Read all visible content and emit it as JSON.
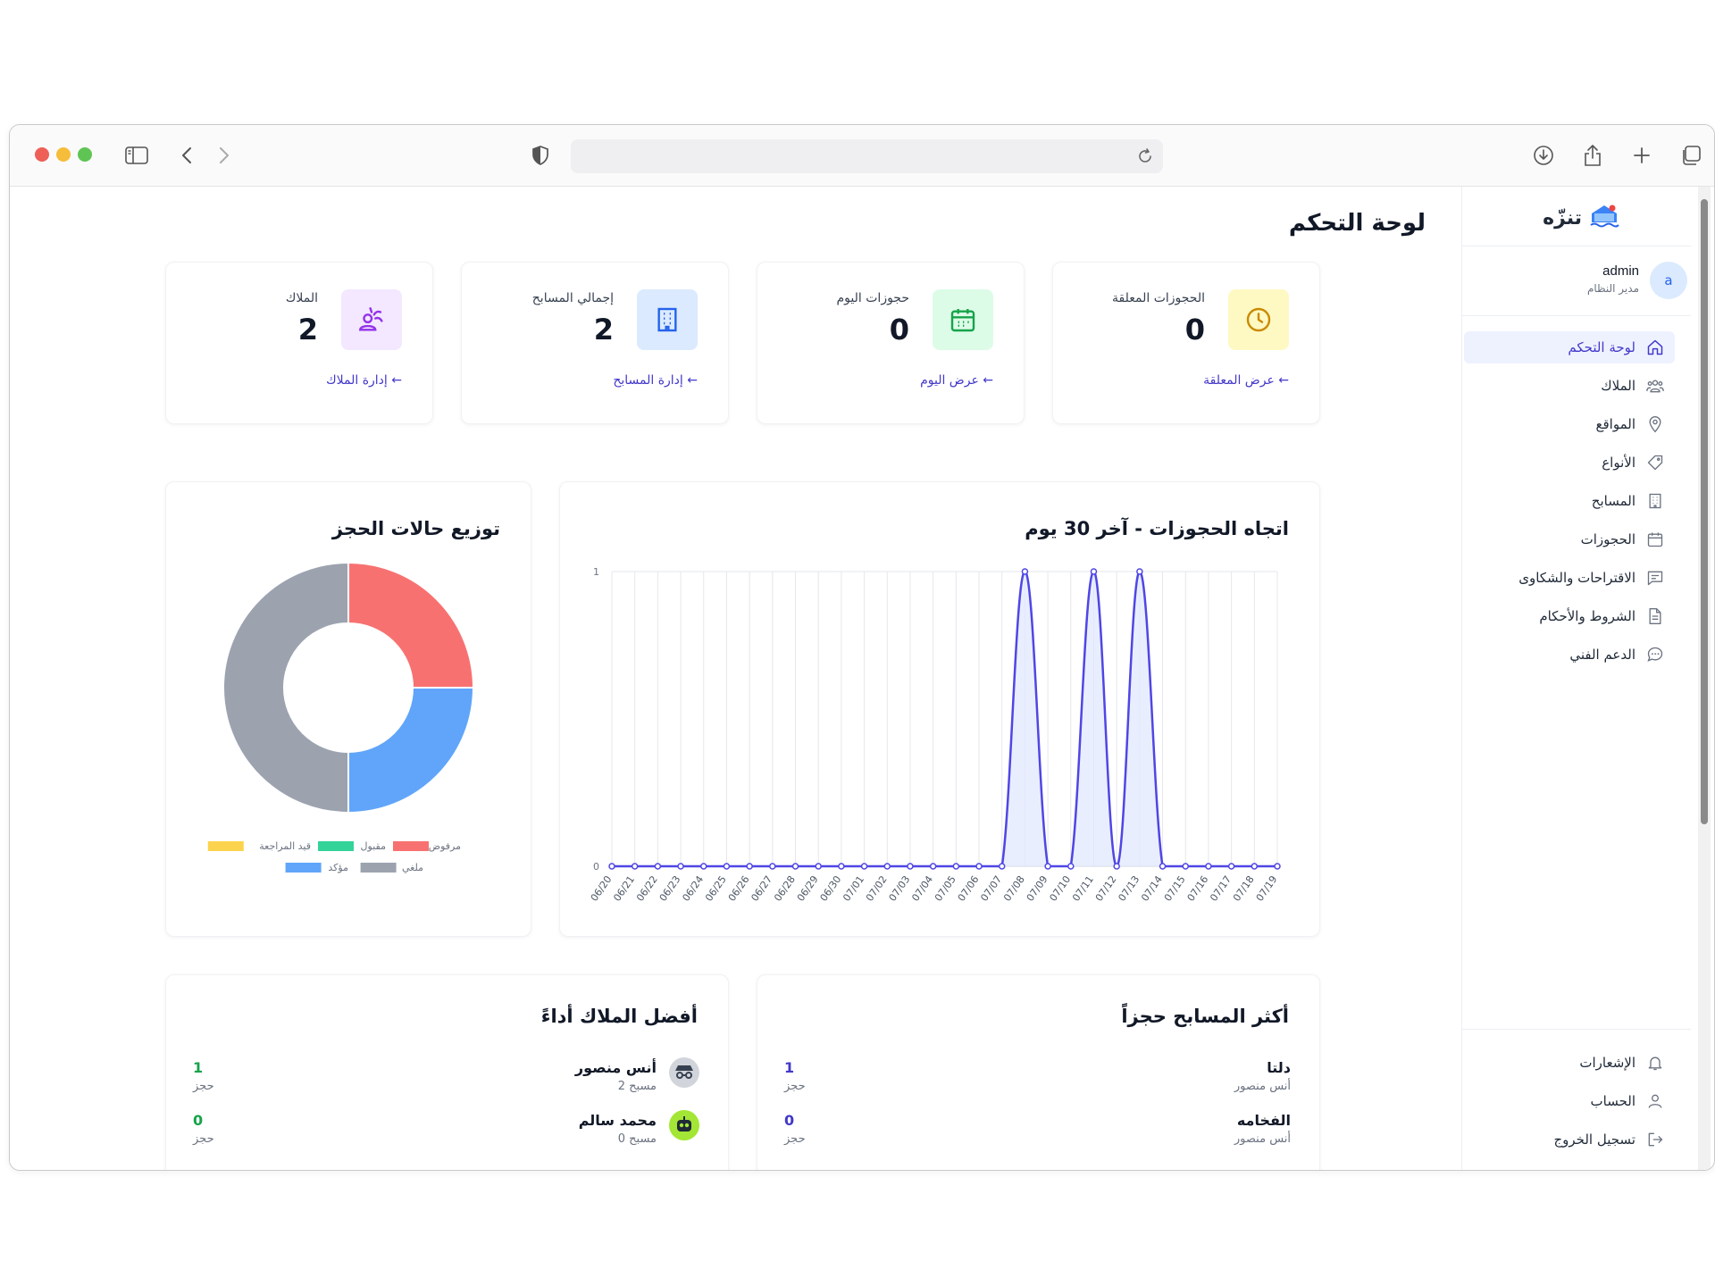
{
  "sidebar": {
    "brand": "تنزّه",
    "user": {
      "name": "admin",
      "role": "مدير النظام",
      "initial": "a"
    },
    "nav": [
      {
        "label": "لوحة التحكم",
        "icon": "home-icon",
        "active": true
      },
      {
        "label": "الملاك",
        "icon": "users-icon"
      },
      {
        "label": "المواقع",
        "icon": "map-pin-icon"
      },
      {
        "label": "الأنواع",
        "icon": "tag-icon"
      },
      {
        "label": "المسابح",
        "icon": "building-icon"
      },
      {
        "label": "الحجوزات",
        "icon": "calendar-icon"
      },
      {
        "label": "الاقتراحات والشكاوى",
        "icon": "message-square-icon"
      },
      {
        "label": "الشروط والأحكام",
        "icon": "file-text-icon"
      },
      {
        "label": "الدعم الفني",
        "icon": "chat-bubble-icon"
      }
    ],
    "bottom": [
      {
        "label": "الإشعارات",
        "icon": "bell-icon"
      },
      {
        "label": "الحساب",
        "icon": "user-icon"
      },
      {
        "label": "تسجيل الخروج",
        "icon": "logout-icon"
      }
    ]
  },
  "page_title": "لوحة التحكم",
  "stats": [
    {
      "label": "الحجوزات المعلقة",
      "value": "0",
      "link": "عرض المعلقة ←",
      "icon": "clock-icon",
      "color": "#ca8a04",
      "bg": "#fef9c3"
    },
    {
      "label": "حجوزات اليوم",
      "value": "0",
      "link": "عرض اليوم ←",
      "icon": "calendar-icon",
      "color": "#16a34a",
      "bg": "#dcfce7"
    },
    {
      "label": "إجمالي المسابح",
      "value": "2",
      "link": "إدارة المسابح ←",
      "icon": "building-icon",
      "color": "#2563eb",
      "bg": "#dbeafe"
    },
    {
      "label": "الملاك",
      "value": "2",
      "link": "إدارة الملاك ←",
      "icon": "owners-icon",
      "color": "#9333ea",
      "bg": "#f3e8ff"
    }
  ],
  "trend": {
    "title": "اتجاه الحجوزات - آخر 30 يوم",
    "chart_data": {
      "type": "area",
      "x": [
        "06/20",
        "06/21",
        "06/22",
        "06/23",
        "06/24",
        "06/25",
        "06/26",
        "06/27",
        "06/28",
        "06/29",
        "06/30",
        "07/01",
        "07/02",
        "07/03",
        "07/04",
        "07/05",
        "07/06",
        "07/07",
        "07/08",
        "07/09",
        "07/10",
        "07/11",
        "07/12",
        "07/13",
        "07/14",
        "07/15",
        "07/16",
        "07/17",
        "07/18",
        "07/19"
      ],
      "values": [
        0,
        0,
        0,
        0,
        0,
        0,
        0,
        0,
        0,
        0,
        0,
        0,
        0,
        0,
        0,
        0,
        0,
        0,
        1,
        0,
        0,
        1,
        0,
        1,
        0,
        0,
        0,
        0,
        0,
        0
      ],
      "ylim": [
        0,
        1
      ],
      "yticks": [
        "0",
        "1"
      ],
      "color": "#4f46e5",
      "fill": "#e0e7ff",
      "grid": true
    }
  },
  "distribution": {
    "title": "توزيع حالات الحجز",
    "chart_data": {
      "type": "pie",
      "variant": "doughnut",
      "labels": [
        "قيد المراجعة",
        "مقبول",
        "مرفوض",
        "مؤكد",
        "ملغي"
      ],
      "values": [
        0,
        0,
        1,
        1,
        2
      ],
      "colors": [
        "#fcd34d",
        "#34d399",
        "#f87171",
        "#60a5fa",
        "#9ca3af"
      ]
    }
  },
  "top_pools": {
    "title": "أكثر المسابح حجزاً",
    "items": [
      {
        "name": "دلتا",
        "owner": "أنس منصور",
        "count": "1",
        "unit": "حجز"
      },
      {
        "name": "الفخامه",
        "owner": "أنس منصور",
        "count": "0",
        "unit": "حجز"
      }
    ]
  },
  "top_owners": {
    "title": "أفضل الملاك أداءً",
    "items": [
      {
        "name": "أنس منصور",
        "pools": "2 مسبح",
        "count": "1",
        "unit": "حجز",
        "avatar": "avatar-incognito-icon"
      },
      {
        "name": "محمد سالم",
        "pools": "0 مسبح",
        "count": "0",
        "unit": "حجز",
        "avatar": "avatar-robot-icon"
      }
    ]
  }
}
